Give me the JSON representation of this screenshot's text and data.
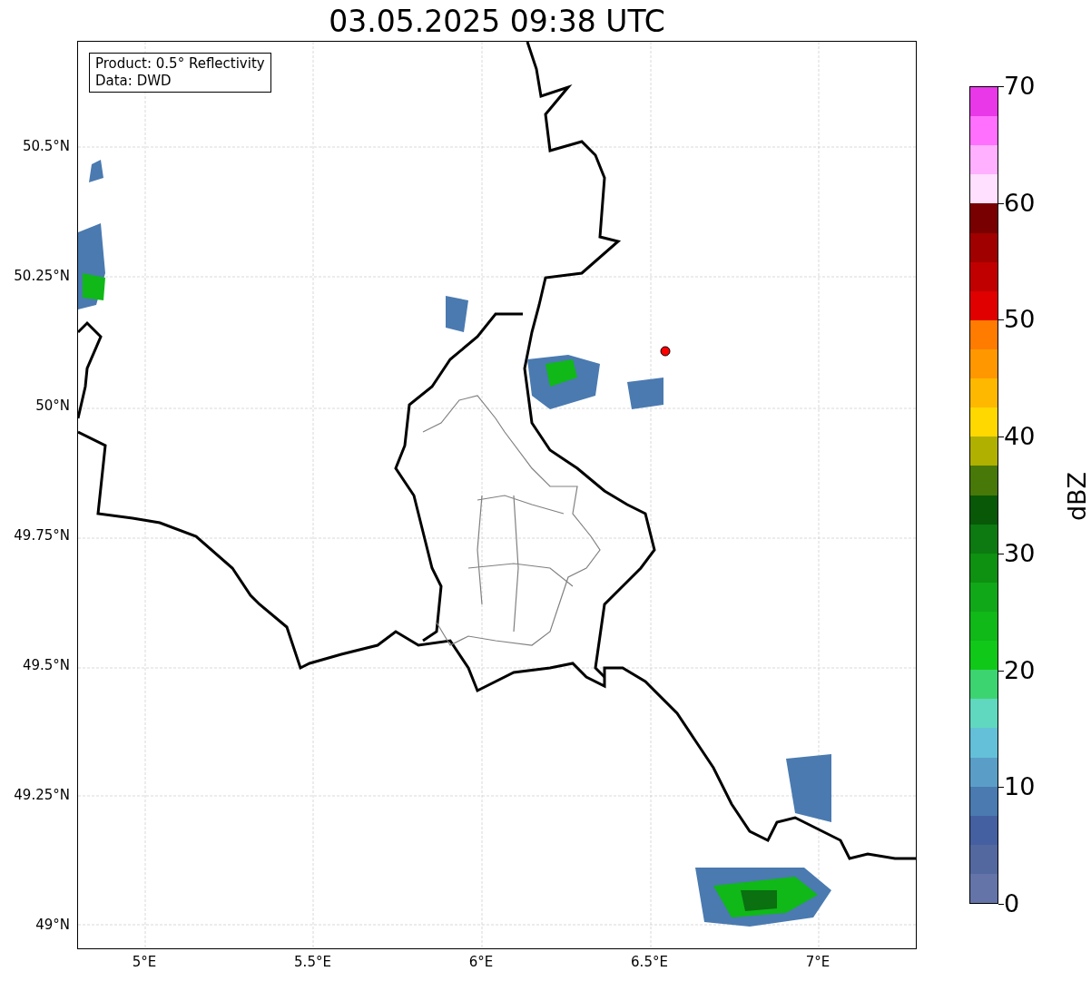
{
  "title": "03.05.2025 09:38 UTC",
  "info_box": {
    "lines": [
      "Product: 0.5° Reflectivity",
      "Data: DWD"
    ]
  },
  "map": {
    "y_tick_labels": [
      "50.5°N",
      "50.25°N",
      "50°N",
      "49.75°N",
      "49.5°N",
      "49.25°N",
      "49°N"
    ],
    "x_tick_labels": [
      "5°E",
      "5.5°E",
      "6°E",
      "6.5°E",
      "7°E"
    ]
  },
  "colorbar": {
    "label": "dBZ",
    "tick_labels": [
      "70",
      "60",
      "50",
      "40",
      "30",
      "20",
      "10",
      "0"
    ],
    "bands": [
      {
        "color": "#e838e8"
      },
      {
        "color": "#ff70ff"
      },
      {
        "color": "#ffb0ff"
      },
      {
        "color": "#ffe0ff"
      },
      {
        "color": "#780000"
      },
      {
        "color": "#a00000"
      },
      {
        "color": "#c00000"
      },
      {
        "color": "#e00000"
      },
      {
        "color": "#ff7c00"
      },
      {
        "color": "#ff9800"
      },
      {
        "color": "#ffb800"
      },
      {
        "color": "#ffd800"
      },
      {
        "color": "#b0b000"
      },
      {
        "color": "#487808"
      },
      {
        "color": "#085808"
      },
      {
        "color": "#0c7a10"
      },
      {
        "color": "#0e9010"
      },
      {
        "color": "#10a818"
      },
      {
        "color": "#10b818"
      },
      {
        "color": "#10c818"
      },
      {
        "color": "#3cd470"
      },
      {
        "color": "#60d8c0"
      },
      {
        "color": "#64c0d8"
      },
      {
        "color": "#5a9ec8"
      },
      {
        "color": "#4a7ab0"
      },
      {
        "color": "#4560a0"
      },
      {
        "color": "#5468a0"
      },
      {
        "color": "#6474a8"
      }
    ]
  }
}
